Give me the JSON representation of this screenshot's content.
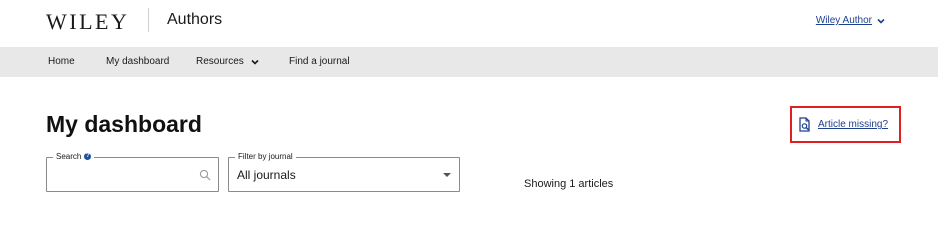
{
  "header": {
    "logo_text": "WILEY",
    "brand_sub": "Authors",
    "account_label": "Wiley Author"
  },
  "nav": {
    "items": [
      {
        "label": "Home"
      },
      {
        "label": "My dashboard"
      },
      {
        "label": "Resources",
        "icon": "chevron-down-icon"
      },
      {
        "label": "Find a journal"
      }
    ]
  },
  "main": {
    "title": "My dashboard",
    "article_missing_label": "Article missing?",
    "search": {
      "label": "Search",
      "value": "",
      "placeholder": ""
    },
    "journal_filter": {
      "label": "Filter by journal",
      "selected": "All journals"
    },
    "result_count_text": "Showing 1 articles"
  },
  "colors": {
    "link": "#1f3f8f",
    "nav_bg": "#e8e8e8",
    "highlight_border": "#e02020"
  }
}
